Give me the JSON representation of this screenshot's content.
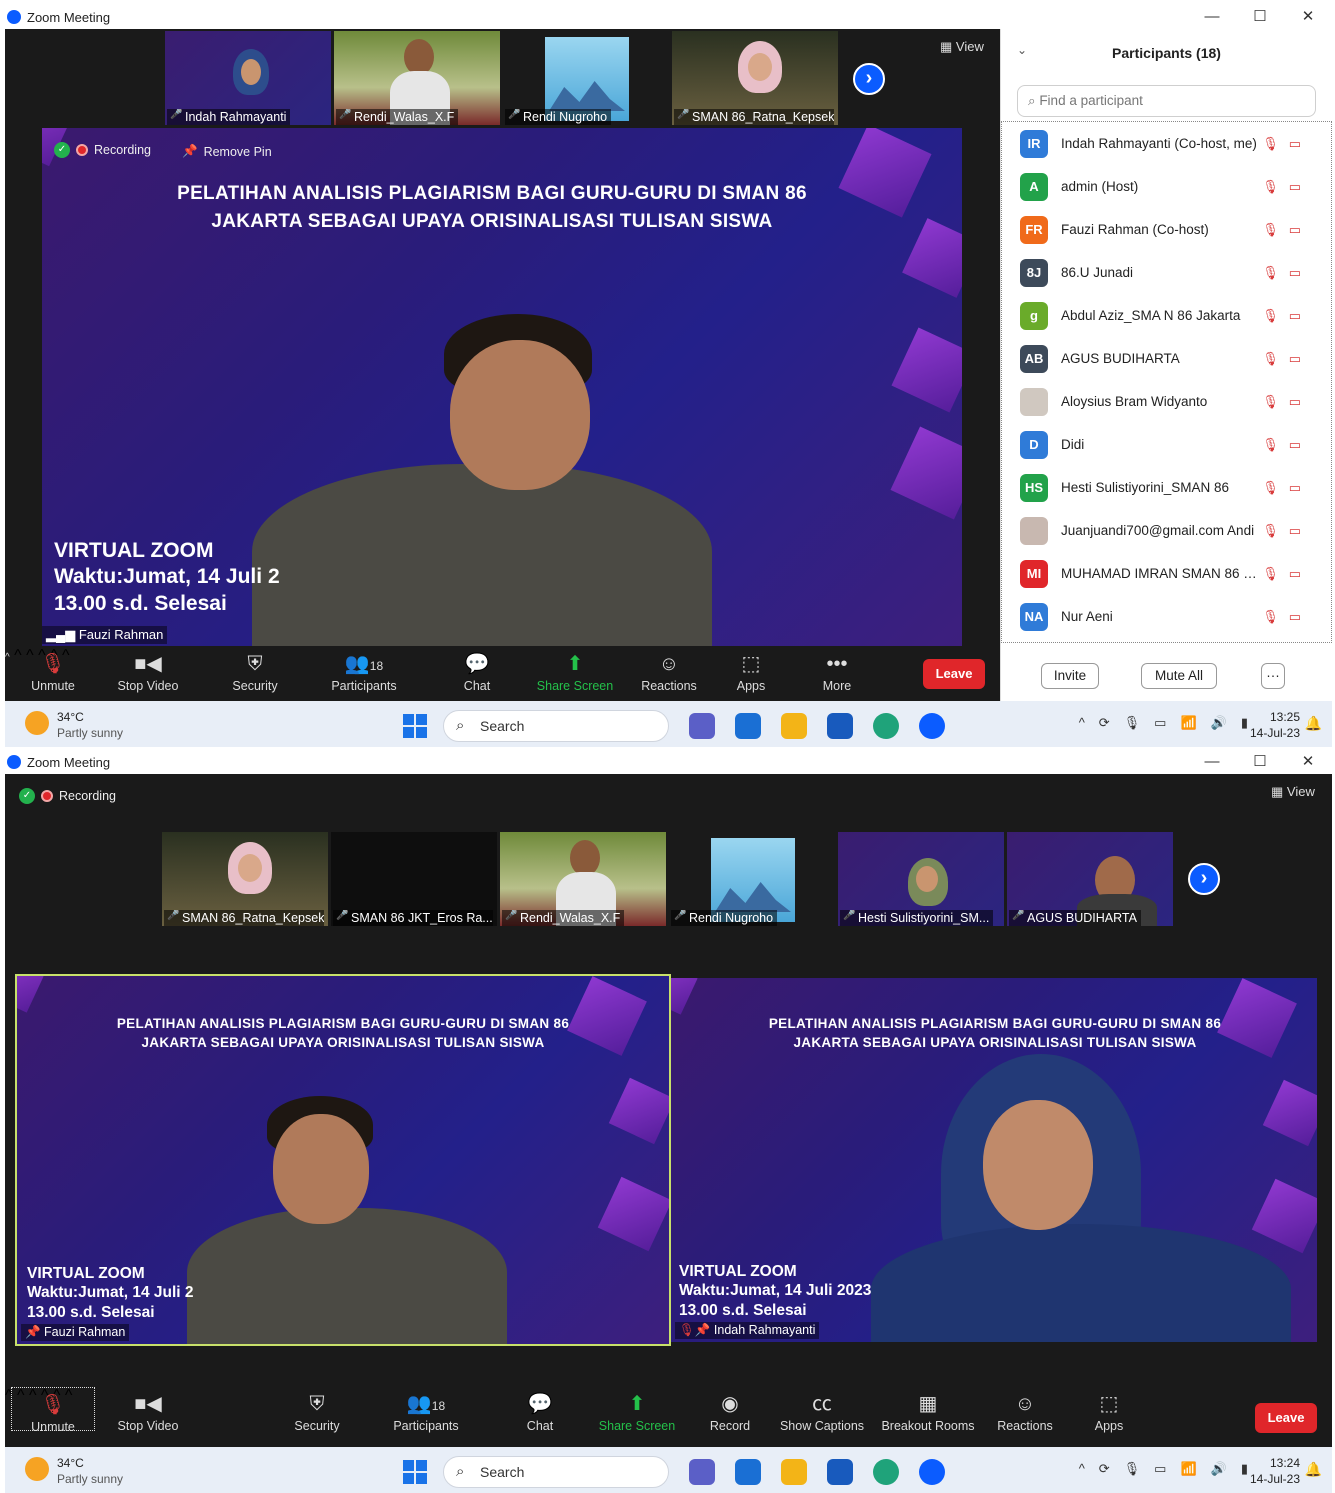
{
  "window": {
    "title": "Zoom Meeting",
    "controls": [
      "—",
      "☐",
      "✕"
    ]
  },
  "top": {
    "thumbnails": [
      {
        "name": "Indah Rahmayanti"
      },
      {
        "name": "Rendi_Walas_X.F"
      },
      {
        "name": "Rendi Nugroho"
      },
      {
        "name": "SMAN 86_Ratna_Kepsek"
      }
    ],
    "view_label": "View",
    "recording_label": "Recording",
    "remove_pin_label": "Remove Pin",
    "slide_title": "PELATIHAN ANALISIS PLAGIARISM BAGI GURU-GURU DI SMAN 86 JAKARTA SEBAGAI UPAYA ORISINALISASI TULISAN SISWA",
    "slide_vz1": "VIRTUAL ZOOM",
    "slide_vz2": "Waktu:Jumat, 14 Juli 2",
    "slide_vz3": "13.00 s.d. Selesai",
    "speaker_name": "Fauzi Rahman",
    "toolbar": {
      "unmute": "Unmute",
      "stop_video": "Stop Video",
      "security": "Security",
      "participants": "Participants",
      "participants_count": "18",
      "chat": "Chat",
      "share_screen": "Share Screen",
      "reactions": "Reactions",
      "apps": "Apps",
      "more": "More",
      "leave": "Leave"
    },
    "panel": {
      "title": "Participants (18)",
      "find_placeholder": "Find a participant",
      "participants": [
        {
          "initials": "IR",
          "name": "Indah Rahmayanti (Co-host, me)",
          "color": "#2f7bd8"
        },
        {
          "initials": "A",
          "name": "admin (Host)",
          "color": "#22a24a"
        },
        {
          "initials": "FR",
          "name": "Fauzi Rahman (Co-host)",
          "color": "#f06a1a"
        },
        {
          "initials": "8J",
          "name": "86.U Junadi",
          "color": "#3d4a5a"
        },
        {
          "initials": "g",
          "name": "Abdul Aziz_SMA N 86 Jakarta",
          "color": "#6aab2a"
        },
        {
          "initials": "AB",
          "name": "AGUS BUDIHARTA",
          "color": "#3d4a5a"
        },
        {
          "initials": "",
          "name": "Aloysius Bram Widyanto",
          "color": "#d0c8c0"
        },
        {
          "initials": "D",
          "name": "Didi",
          "color": "#2f7bd8"
        },
        {
          "initials": "HS",
          "name": "Hesti Sulistiyorini_SMAN 86",
          "color": "#22a24a"
        },
        {
          "initials": "",
          "name": "Juanjuandi700@gmail.com Andi",
          "color": "#c8b8b0"
        },
        {
          "initials": "MI",
          "name": "MUHAMAD IMRAN SMAN 86 J...",
          "color": "#e0262a"
        },
        {
          "initials": "NA",
          "name": "Nur Aeni",
          "color": "#2f7bd8"
        }
      ],
      "invite": "Invite",
      "mute_all": "Mute All",
      "more": "···"
    },
    "taskbar": {
      "temp": "34°C",
      "weather": "Partly sunny",
      "search": "Search",
      "time": "13:25",
      "date": "14-Jul-23"
    }
  },
  "bottom": {
    "recording_label": "Recording",
    "view_label": "View",
    "thumbnails": [
      {
        "name": "SMAN 86_Ratna_Kepsek"
      },
      {
        "name": "SMAN 86 JKT_Eros Ra..."
      },
      {
        "name": "Rendi_Walas_X.F"
      },
      {
        "name": "Rendi Nugroho"
      },
      {
        "name": "Hesti Sulistiyorini_SM..."
      },
      {
        "name": "AGUS BUDIHARTA"
      }
    ],
    "left_tile": {
      "slide_title": "PELATIHAN ANALISIS PLAGIARISM BAGI GURU-GURU DI SMAN 86 JAKARTA SEBAGAI UPAYA ORISINALISASI TULISAN SISWA",
      "vz1": "VIRTUAL ZOOM",
      "vz2": "Waktu:Jumat, 14 Juli 2",
      "vz3": "13.00 s.d. Selesai",
      "name": "Fauzi Rahman"
    },
    "right_tile": {
      "slide_title": "PELATIHAN ANALISIS PLAGIARISM BAGI GURU-GURU DI SMAN 86 JAKARTA SEBAGAI UPAYA ORISINALISASI TULISAN SISWA",
      "vz1": "VIRTUAL ZOOM",
      "vz2": "Waktu:Jumat, 14 Juli 2023",
      "vz3": "13.00 s.d. Selesai",
      "name": "Indah Rahmayanti"
    },
    "toolbar": {
      "unmute": "Unmute",
      "stop_video": "Stop Video",
      "security": "Security",
      "participants": "Participants",
      "participants_count": "18",
      "chat": "Chat",
      "share_screen": "Share Screen",
      "record": "Record",
      "show_captions": "Show Captions",
      "breakout_rooms": "Breakout Rooms",
      "reactions": "Reactions",
      "apps": "Apps",
      "leave": "Leave"
    },
    "taskbar": {
      "temp": "34°C",
      "weather": "Partly sunny",
      "search": "Search",
      "time": "13:24",
      "date": "14-Jul-23"
    }
  }
}
